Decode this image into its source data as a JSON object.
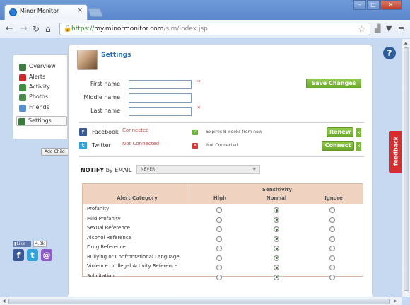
{
  "browser": {
    "tab_title": "Minor Monitor",
    "tab_close": "×",
    "url_scheme": "https://",
    "url_host": "my.minormonitor.com",
    "url_path": "/sim/index.jsp",
    "window_min": "–",
    "window_max": "□",
    "window_close": "✕"
  },
  "sidebar": {
    "items": [
      {
        "label": "Overview",
        "color": "#3d7a3d"
      },
      {
        "label": "Alerts",
        "color": "#cc2a2a"
      },
      {
        "label": "Activity",
        "color": "#3f8f3f"
      },
      {
        "label": "Photos",
        "color": "#4a8a4a"
      },
      {
        "label": "Friends",
        "color": "#5a8fd0"
      },
      {
        "label": "Settings",
        "color": "#3a7a3a"
      }
    ],
    "add_child": "Add Child"
  },
  "social": {
    "like_label": "Like",
    "like_count": "4.3k"
  },
  "settings": {
    "title": "Settings",
    "first_name_label": "First name",
    "middle_name_label": "Middle name",
    "last_name_label": "Last name",
    "first_name_value": "",
    "middle_name_value": "",
    "last_name_value": "",
    "required_mark": "*",
    "save_button": "Save Changes"
  },
  "networks": [
    {
      "name": "Facebook",
      "status": "Connected",
      "note": "Expires 8 weeks from now",
      "action": "Renew",
      "x": "x",
      "check_color": "#6fb33a"
    },
    {
      "name": "Twitter",
      "status": "Not Connected",
      "note": "Not Connected",
      "action": "Connect",
      "x": "x",
      "check_color": "#d23a3a"
    }
  ],
  "notify": {
    "label_strong": "NOTIFY",
    "label_rest": " by EMAIL",
    "selected": "NEVER"
  },
  "alerts_table": {
    "sensitivity_header": "Sensitivity",
    "category_header": "Alert Category",
    "columns": [
      "High",
      "Normal",
      "Ignore"
    ],
    "rows": [
      {
        "category": "Profanity",
        "selected": "Normal"
      },
      {
        "category": "Mild Profanity",
        "selected": "Normal"
      },
      {
        "category": "Sexual Reference",
        "selected": "Normal"
      },
      {
        "category": "Alcohol Reference",
        "selected": "Normal"
      },
      {
        "category": "Drug Reference",
        "selected": "Normal"
      },
      {
        "category": "Bullying or Confrontational Language",
        "selected": "Normal"
      },
      {
        "category": "Violence or Illegal Activity Reference",
        "selected": "Normal"
      },
      {
        "category": "Solicitation",
        "selected": "Normal"
      }
    ]
  },
  "help_label": "?",
  "feedback_label": "feedback"
}
